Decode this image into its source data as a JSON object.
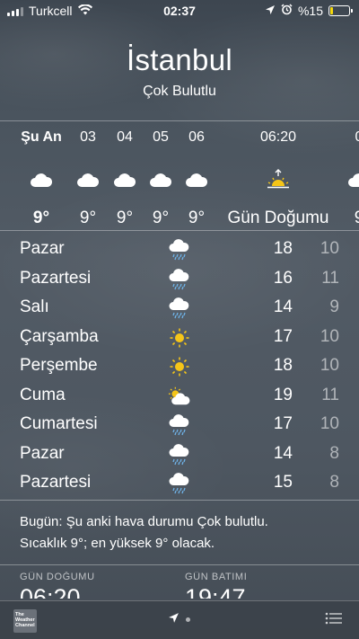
{
  "status_bar": {
    "carrier": "Turkcell",
    "time": "02:37",
    "battery": "%15",
    "battery_level": 0.15,
    "battery_color": "#f5d90a",
    "icons": [
      "signal-icon",
      "wifi-icon",
      "location-arrow-icon",
      "alarm-icon",
      "battery-icon"
    ]
  },
  "header": {
    "city": "İstanbul",
    "condition": "Çok Bulutlu"
  },
  "hourly": [
    {
      "time": "Şu An",
      "icon": "cloud-icon",
      "value": "9°"
    },
    {
      "time": "03",
      "icon": "cloud-icon",
      "value": "9°"
    },
    {
      "time": "04",
      "icon": "cloud-icon",
      "value": "9°"
    },
    {
      "time": "05",
      "icon": "cloud-icon",
      "value": "9°"
    },
    {
      "time": "06",
      "icon": "cloud-icon",
      "value": "9°"
    },
    {
      "time": "06:20",
      "icon": "sunrise-icon",
      "value": "Gün Doğumu"
    },
    {
      "time": "0",
      "icon": "cloud-icon",
      "value": "9"
    }
  ],
  "daily": [
    {
      "day": "Pazar",
      "icon": "rain-cloud-icon",
      "high": "18",
      "low": "10"
    },
    {
      "day": "Pazartesi",
      "icon": "rain-cloud-icon",
      "high": "16",
      "low": "11"
    },
    {
      "day": "Salı",
      "icon": "rain-cloud-icon",
      "high": "14",
      "low": "9"
    },
    {
      "day": "Çarşamba",
      "icon": "sun-icon",
      "high": "17",
      "low": "10"
    },
    {
      "day": "Perşembe",
      "icon": "sun-icon",
      "high": "18",
      "low": "10"
    },
    {
      "day": "Cuma",
      "icon": "partly-sunny-icon",
      "high": "19",
      "low": "11"
    },
    {
      "day": "Cumartesi",
      "icon": "rain-cloud-icon",
      "high": "17",
      "low": "10"
    },
    {
      "day": "Pazar",
      "icon": "rain-cloud-icon",
      "high": "14",
      "low": "8"
    },
    {
      "day": "Pazartesi",
      "icon": "rain-cloud-icon",
      "high": "15",
      "low": "8"
    }
  ],
  "summary": {
    "line1": "Bugün: Şu anki hava durumu Çok bulutlu.",
    "line2": "Sıcaklık 9°; en yüksek 9° olacak."
  },
  "sun": {
    "sunrise_label": "GÜN DOĞUMU",
    "sunrise_value": "06:20",
    "sunset_label": "GÜN BATIMI",
    "sunset_value": "19:47"
  },
  "bottom_bar": {
    "logo_text": "The Weather Channel",
    "icons": [
      "weather-channel-logo",
      "location-arrow-icon",
      "page-dot",
      "list-icon"
    ]
  },
  "colors": {
    "sun": "#f5c518",
    "low_temp": "rgba(255,255,255,0.55)"
  }
}
